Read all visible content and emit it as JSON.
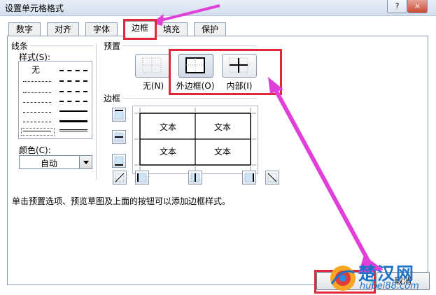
{
  "window": {
    "title": "设置单元格格式",
    "help_label": "?",
    "close_label": "×"
  },
  "tabs": [
    {
      "label": "数字"
    },
    {
      "label": "对齐"
    },
    {
      "label": "字体"
    },
    {
      "label": "边框",
      "active": true
    },
    {
      "label": "填充"
    },
    {
      "label": "保护"
    }
  ],
  "line_section": {
    "title": "线条",
    "style_label": "样式(S):",
    "none_label": "无",
    "color_label": "颜色(C):",
    "color_value": "自动"
  },
  "preset_section": {
    "title": "预置",
    "buttons": [
      {
        "label": "无(N)"
      },
      {
        "label": "外边框(O)"
      },
      {
        "label": "内部(I)"
      }
    ]
  },
  "border_section": {
    "title": "边框",
    "cells": [
      "文本",
      "文本",
      "文本",
      "文本"
    ]
  },
  "hint": "单击预置选项、预览草图及上面的按钮可以添加边框样式。",
  "footer": {
    "cancel_label": "取消"
  },
  "watermark": {
    "cn": "楚汉网",
    "url": "hubei88.com"
  },
  "colors": {
    "highlight": "#e0283c",
    "annotation_arrow": "#e040d8"
  }
}
